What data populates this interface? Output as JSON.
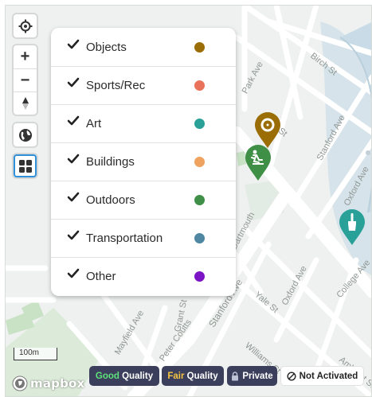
{
  "streets": [
    "Birch St",
    "Park Ave",
    "Ash St",
    "Stanford Ave",
    "Oxford Ave",
    "College Ave",
    "Stanford Ave",
    "Yale St",
    "Oxford Ave",
    "Williams St",
    "Amherst St",
    "Dartmouth",
    "Grant St",
    "Mayfield Ave",
    "Peter Coutts"
  ],
  "controls": {
    "locate_icon": "crosshair-icon",
    "zoom_in_symbol": "+",
    "zoom_out_symbol": "−",
    "compass_icon": "compass-icon",
    "globe_icon": "globe-icon",
    "layers_icon": "grid-icon"
  },
  "legend": {
    "items": [
      {
        "label": "Objects",
        "checked": true,
        "color": "#9b6d06"
      },
      {
        "label": "Sports/Rec",
        "checked": true,
        "color": "#e8735a"
      },
      {
        "label": "Art",
        "checked": true,
        "color": "#2aa198"
      },
      {
        "label": "Buildings",
        "checked": true,
        "color": "#f0a35e"
      },
      {
        "label": "Outdoors",
        "checked": true,
        "color": "#3f8f47"
      },
      {
        "label": "Transportation",
        "checked": true,
        "color": "#4f86a2"
      },
      {
        "label": "Other",
        "checked": true,
        "color": "#7b14c4"
      }
    ]
  },
  "markers": [
    {
      "icon": "location-pin-icon",
      "color": "#9b6d06"
    },
    {
      "icon": "rider-icon",
      "color": "#3f8f47"
    },
    {
      "icon": "brush-icon",
      "color": "#2aa198"
    }
  ],
  "scale_label": "100m",
  "attribution": {
    "logo_text": "mapbox"
  },
  "quality_badges": {
    "good_word": "Good",
    "good_rest": " Quality",
    "fair_word": "Fair",
    "fair_rest": " Quality",
    "private_label": "Private",
    "not_activated_label": "Not Activated",
    "good_color": "#5ee07a",
    "fair_color": "#f5c542",
    "badge_bg": "#3b3f5c"
  }
}
